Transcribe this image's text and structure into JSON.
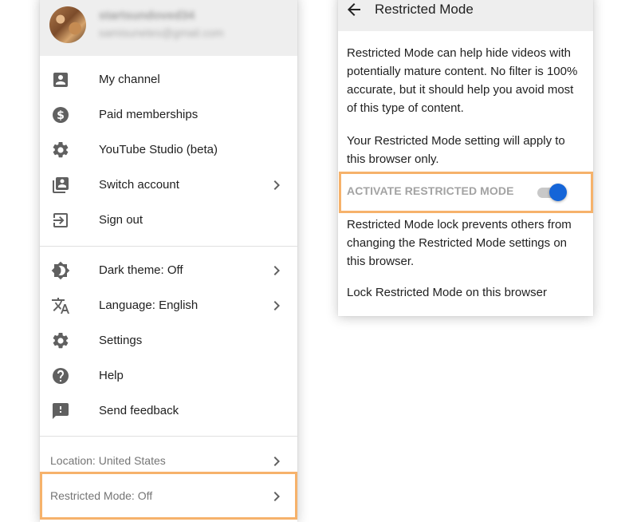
{
  "account": {
    "name": "startsundoved34",
    "email": "samisunetes@gmail.com"
  },
  "menu": {
    "section1": [
      {
        "label": "My channel",
        "icon": "account-box-icon"
      },
      {
        "label": "Paid memberships",
        "icon": "dollar-circle-icon"
      },
      {
        "label": "YouTube Studio (beta)",
        "icon": "gear-icon"
      },
      {
        "label": "Switch account",
        "icon": "switch-account-icon",
        "has_chevron": true
      },
      {
        "label": "Sign out",
        "icon": "exit-icon"
      }
    ],
    "section2": [
      {
        "label": "Dark theme: Off",
        "icon": "brightness-icon",
        "has_chevron": true
      },
      {
        "label": "Language: English",
        "icon": "translate-icon",
        "has_chevron": true
      },
      {
        "label": "Settings",
        "icon": "gear-icon"
      },
      {
        "label": "Help",
        "icon": "help-circle-icon"
      },
      {
        "label": "Send feedback",
        "icon": "feedback-icon"
      }
    ],
    "footer": [
      {
        "label": "Location: United States"
      },
      {
        "label": "Restricted Mode: Off"
      }
    ]
  },
  "restricted_panel": {
    "title": "Restricted Mode",
    "description": "Restricted Mode can help hide videos with potentially mature content. No filter is 100% accurate, but it should help you avoid most of this type of content.",
    "browser_note": "Your Restricted Mode setting will apply to this browser only.",
    "activate_label": "ACTIVATE RESTRICTED MODE",
    "toggle_on": true,
    "lock_description": "Restricted Mode lock prevents others from changing the Restricted Mode settings on this browser.",
    "lock_link": "Lock Restricted Mode on this browser"
  },
  "colors": {
    "highlight": "#f6b26b",
    "toggle_knob": "#1565d8",
    "header_bg": "#eeeeee",
    "icon": "#606060"
  }
}
